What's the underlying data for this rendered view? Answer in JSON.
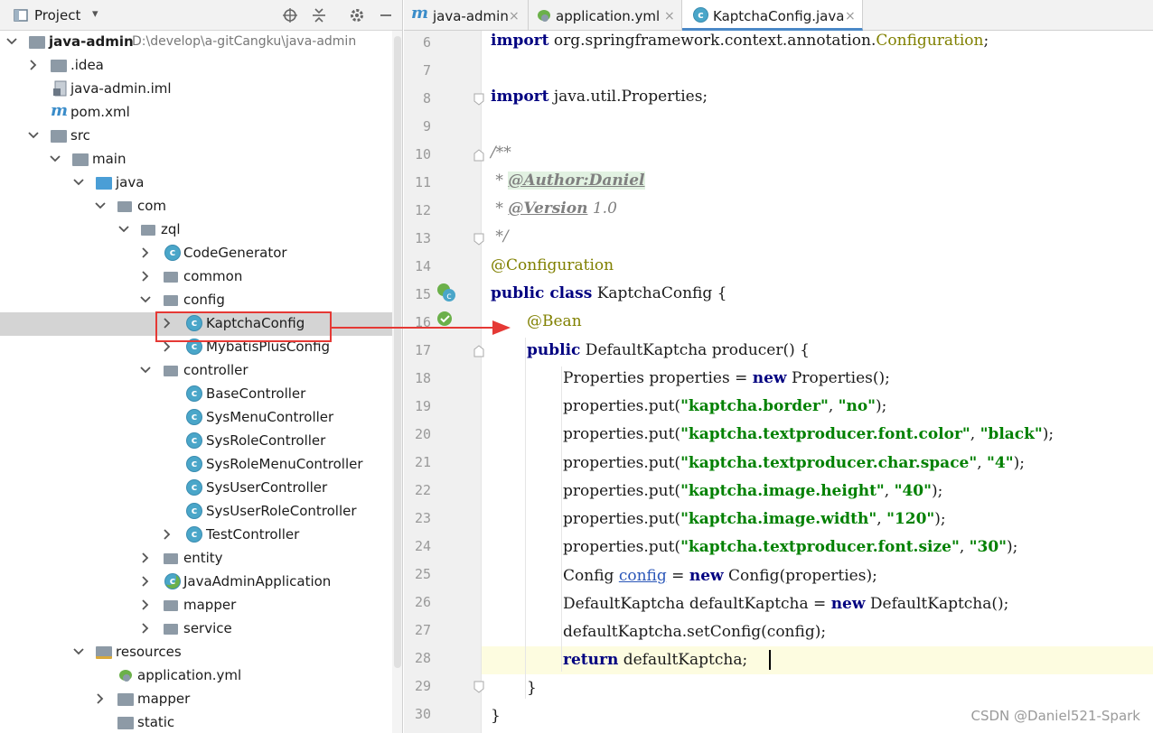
{
  "project_panel": {
    "title": "Project",
    "dropdown": "▾",
    "toolbar_icons": [
      "target-icon",
      "collapse-icon",
      "gear-icon",
      "minimize-icon"
    ],
    "tree": [
      {
        "label": "java-admin",
        "path": "D:\\develop\\a-gitCangku\\java-admin",
        "icon": "module-folder-icon",
        "bold": true
      },
      {
        "label": ".idea",
        "icon": "folder-icon"
      },
      {
        "label": "java-admin.iml",
        "icon": "iml-file-icon"
      },
      {
        "label": "pom.xml",
        "icon": "maven-icon"
      },
      {
        "label": "src",
        "icon": "folder-icon"
      },
      {
        "label": "main",
        "icon": "folder-icon"
      },
      {
        "label": "java",
        "icon": "source-folder-icon"
      },
      {
        "label": "com",
        "icon": "package-icon"
      },
      {
        "label": "zql",
        "icon": "package-icon"
      },
      {
        "label": "CodeGenerator",
        "icon": "class-icon"
      },
      {
        "label": "common",
        "icon": "package-icon"
      },
      {
        "label": "config",
        "icon": "package-icon"
      },
      {
        "label": "KaptchaConfig",
        "icon": "class-icon"
      },
      {
        "label": "MybatisPlusConfig",
        "icon": "class-icon"
      },
      {
        "label": "controller",
        "icon": "package-icon"
      },
      {
        "label": "BaseController",
        "icon": "class-icon"
      },
      {
        "label": "SysMenuController",
        "icon": "class-icon"
      },
      {
        "label": "SysRoleController",
        "icon": "class-icon"
      },
      {
        "label": "SysRoleMenuController",
        "icon": "class-icon"
      },
      {
        "label": "SysUserController",
        "icon": "class-icon"
      },
      {
        "label": "SysUserRoleController",
        "icon": "class-icon"
      },
      {
        "label": "TestController",
        "icon": "class-icon"
      },
      {
        "label": "entity",
        "icon": "package-icon"
      },
      {
        "label": "JavaAdminApplication",
        "icon": "spring-class-icon"
      },
      {
        "label": "mapper",
        "icon": "package-icon"
      },
      {
        "label": "service",
        "icon": "package-icon"
      },
      {
        "label": "resources",
        "icon": "resources-folder-icon"
      },
      {
        "label": "application.yml",
        "icon": "yml-file-icon"
      },
      {
        "label": "mapper",
        "icon": "folder-icon"
      },
      {
        "label": "static",
        "icon": "folder-icon"
      }
    ]
  },
  "tabs": [
    {
      "label": "java-admin",
      "icon": "maven-icon",
      "close": "×"
    },
    {
      "label": "application.yml",
      "icon": "spring-leaf-icon",
      "close": "×"
    },
    {
      "label": "KaptchaConfig.java",
      "icon": "class-icon",
      "close": "×"
    }
  ],
  "editor": {
    "line_numbers": [
      "6",
      "7",
      "8",
      "9",
      "10",
      "11",
      "12",
      "13",
      "14",
      "15",
      "16",
      "17",
      "18",
      "19",
      "20",
      "21",
      "22",
      "23",
      "24",
      "25",
      "26",
      "27",
      "28",
      "29",
      "30"
    ],
    "code": {
      "l6_a": "import",
      "l6_b": " org.springframework.context.annotation.",
      "l6_c": "Configuration",
      "l6_d": ";",
      "l8_a": "import",
      "l8_b": " java.util.Properties;",
      "l10": "/**",
      "l11_a": " * ",
      "l11_b": "@Author:Daniel",
      "l12_a": " * ",
      "l12_b": "@Version",
      "l12_c": " 1.0",
      "l13": " */",
      "l14": "@Configuration",
      "l15_a": "public class",
      "l15_b": " KaptchaConfig {",
      "l16": "@Bean",
      "l17_a": "public",
      "l17_b": " DefaultKaptcha producer() {",
      "l18_a": "Properties properties = ",
      "l18_b": "new",
      "l18_c": " Properties();",
      "put_prefix": "properties.put(",
      "l19_k": "\"kaptcha.border\"",
      "l19_v": "\"no\"",
      "l20_k": "\"kaptcha.textproducer.font.color\"",
      "l20_v": "\"black\"",
      "l21_k": "\"kaptcha.textproducer.char.space\"",
      "l21_v": "\"4\"",
      "l22_k": "\"kaptcha.image.height\"",
      "l22_v": "\"40\"",
      "l23_k": "\"kaptcha.image.width\"",
      "l23_v": "\"120\"",
      "l24_k": "\"kaptcha.textproducer.font.size\"",
      "l24_v": "\"30\"",
      "sep": ", ",
      "end": ");",
      "l25_a": "Config ",
      "l25_b": "config",
      "l25_c": " = ",
      "l25_d": "new",
      "l25_e": " Config(properties);",
      "l26_a": "DefaultKaptcha defaultKaptcha = ",
      "l26_b": "new",
      "l26_c": " DefaultKaptcha();",
      "l27": "defaultKaptcha.setConfig(config);",
      "l28_a": "return",
      "l28_b": " defaultKaptcha;",
      "l29": "}",
      "l30": "}"
    }
  },
  "watermark": "CSDN @Daniel521-Spark",
  "colors": {
    "keyword": "#000080",
    "annotation": "#808000",
    "string": "#008000",
    "comment": "#808080",
    "highlight_box": "#e53935",
    "selection": "#d4d4d4"
  }
}
